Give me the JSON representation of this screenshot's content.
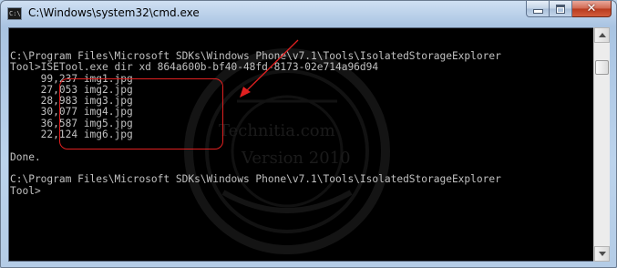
{
  "window": {
    "title": "C:\\Windows\\system32\\cmd.exe",
    "icon_text": "C:\\"
  },
  "caption_buttons": {
    "minimize_icon": "minimize-icon",
    "maximize_icon": "maximize-icon",
    "close_icon": "close-icon",
    "close_glyph": "✕"
  },
  "console": {
    "lines": [
      "C:\\Program Files\\Microsoft SDKs\\Windows Phone\\v7.1\\Tools\\IsolatedStorageExplorer",
      "Tool>ISETool.exe dir xd 864a600b-bf40-48fd-8173-02e714a96d94",
      "     99,237 img1.jpg",
      "     27,053 img2.jpg",
      "     28,983 img3.jpg",
      "     30,077 img4.jpg",
      "     36,587 img5.jpg",
      "     22,124 img6.jpg",
      "",
      "Done.",
      "",
      "C:\\Program Files\\Microsoft SDKs\\Windows Phone\\v7.1\\Tools\\IsolatedStorageExplorer",
      "Tool>"
    ],
    "text_color": "#c0c0c0",
    "background": "#000000"
  },
  "annotation": {
    "highlight_color": "#e02020"
  },
  "watermark": {
    "line1": "Technitia.com",
    "line2": "Version 2010"
  }
}
